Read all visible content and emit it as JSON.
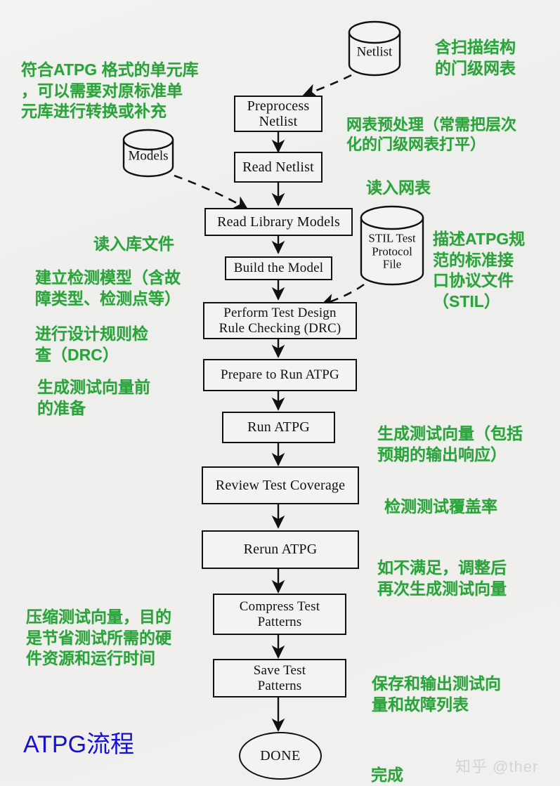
{
  "diagram": {
    "title": "ATPG流程",
    "watermark": "知乎 @ther",
    "accent_green": "#2aa33a",
    "title_color": "#1410d8",
    "line_color": "#111111",
    "background": "#f0f0ee"
  },
  "nodes": [
    {
      "id": "preprocess_netlist",
      "label": "Preprocess\nNetlist"
    },
    {
      "id": "read_netlist",
      "label": "Read Netlist"
    },
    {
      "id": "read_library_models",
      "label": "Read Library Models"
    },
    {
      "id": "build_the_model",
      "label": "Build the Model"
    },
    {
      "id": "perform_drc",
      "label": "Perform Test Design\nRule Checking (DRC)"
    },
    {
      "id": "prepare_to_run_atpg",
      "label": "Prepare to Run ATPG"
    },
    {
      "id": "run_atpg",
      "label": "Run ATPG"
    },
    {
      "id": "review_test_coverage",
      "label": "Review Test Coverage"
    },
    {
      "id": "rerun_atpg",
      "label": "Rerun ATPG"
    },
    {
      "id": "compress_test_patterns",
      "label": "Compress Test\nPatterns"
    },
    {
      "id": "save_test_patterns",
      "label": "Save Test\nPatterns"
    }
  ],
  "terminal": {
    "id": "done",
    "label": "DONE"
  },
  "datastores": [
    {
      "id": "netlist",
      "label": "Netlist"
    },
    {
      "id": "models",
      "label": "Models"
    },
    {
      "id": "stil",
      "label": "STIL Test\nProtocol\nFile"
    }
  ],
  "annotations": [
    {
      "id": "cell-library-note",
      "text": "符合ATPG 格式的单元库\n，可以需要对原标准单\n元库进行转换或补充"
    },
    {
      "id": "scan-netlist-note",
      "text": "含扫描结构\n的门级网表"
    },
    {
      "id": "preprocess-note",
      "text": "网表预处理（常需把层次\n化的门级网表打平）"
    },
    {
      "id": "read-netlist-note",
      "text": "读入网表"
    },
    {
      "id": "read-library-note",
      "text": "读入库文件"
    },
    {
      "id": "stil-note",
      "text": "描述ATPG规\n范的标准接\n口协议文件\n（STIL）"
    },
    {
      "id": "build-model-note",
      "text": "建立检测模型（含故\n障类型、检测点等）"
    },
    {
      "id": "drc-note",
      "text": "进行设计规则检\n查（DRC）"
    },
    {
      "id": "prepare-note",
      "text": "生成测试向量前\n的准备"
    },
    {
      "id": "run-atpg-note",
      "text": "生成测试向量（包括\n预期的输出响应）"
    },
    {
      "id": "review-note",
      "text": "检测测试覆盖率"
    },
    {
      "id": "rerun-note",
      "text": "如不满足，调整后\n再次生成测试向量"
    },
    {
      "id": "compress-note",
      "text": "压缩测试向量，目的\n是节省测试所需的硬\n件资源和运行时间"
    },
    {
      "id": "save-note",
      "text": "保存和输出测试向\n量和故障列表"
    },
    {
      "id": "done-note",
      "text": "完成"
    }
  ]
}
